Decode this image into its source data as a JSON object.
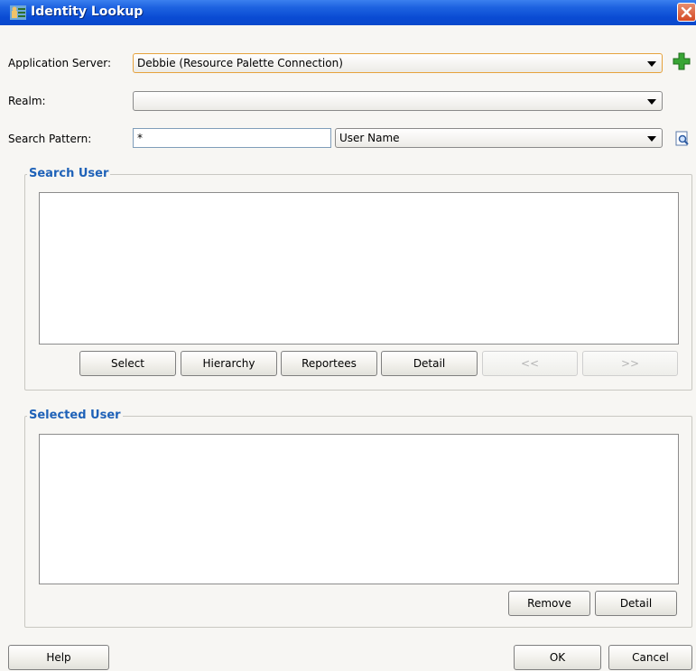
{
  "window": {
    "title": "Identity Lookup"
  },
  "form": {
    "app_server_label": "Application Server:",
    "app_server_value": "Debbie (Resource Palette Connection)",
    "realm_label": "Realm:",
    "realm_value": "",
    "search_pattern_label": "Search Pattern:",
    "search_pattern_value": "*",
    "search_field_value": "User Name"
  },
  "search_user": {
    "title": "Search User",
    "buttons": {
      "select": "Select",
      "hierarchy": "Hierarchy",
      "reportees": "Reportees",
      "detail": "Detail",
      "prev": "<<",
      "next": ">>"
    }
  },
  "selected_user": {
    "title": "Selected User",
    "buttons": {
      "remove": "Remove",
      "detail": "Detail"
    }
  },
  "footer": {
    "help": "Help",
    "ok": "OK",
    "cancel": "Cancel"
  },
  "icons": {
    "title": "identity-lookup-icon",
    "close": "close-icon",
    "add": "add-connection-icon",
    "find": "find-icon"
  }
}
